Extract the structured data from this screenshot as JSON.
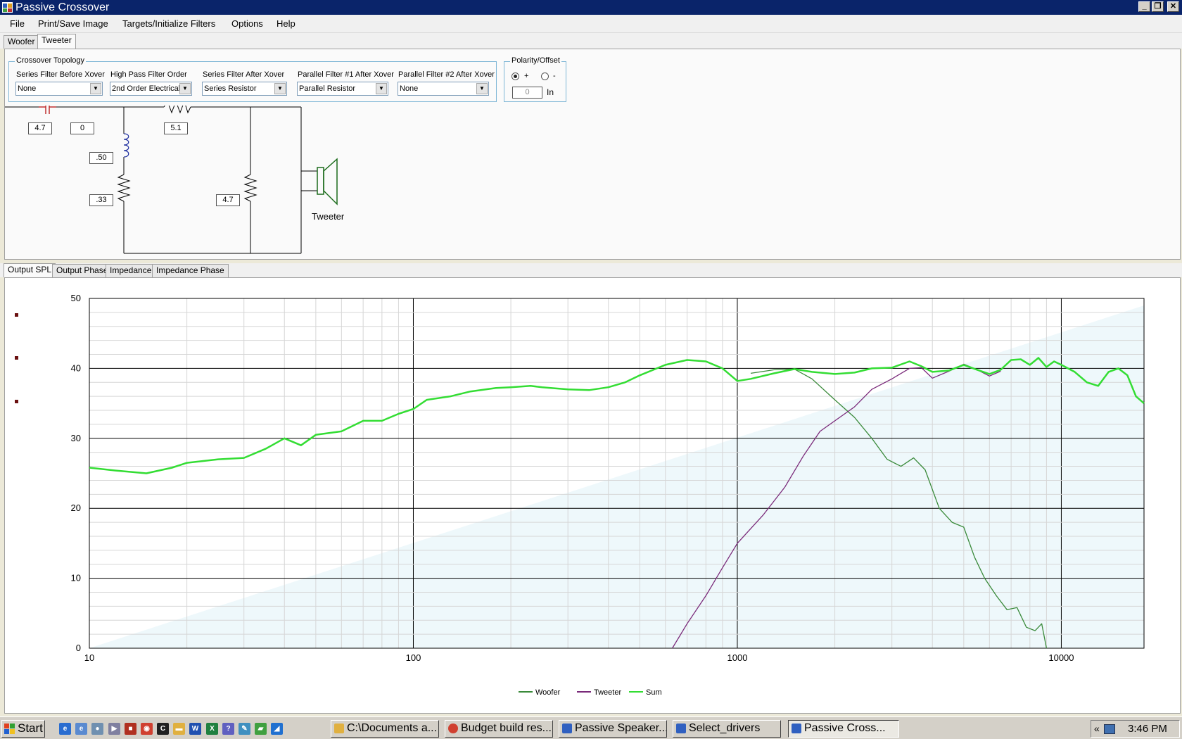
{
  "window": {
    "title": "Passive Crossover"
  },
  "menu": [
    "File",
    "Print/Save Image",
    "Targets/Initialize Filters",
    "Options",
    "Help"
  ],
  "driver_tabs": [
    {
      "label": "Woofer",
      "active": false
    },
    {
      "label": "Tweeter",
      "active": true
    }
  ],
  "topology": {
    "title": "Crossover Topology",
    "filters": [
      {
        "label": "Series Filter Before Xover",
        "value": "None"
      },
      {
        "label": "High Pass Filter Order",
        "value": "2nd Order Electrical"
      },
      {
        "label": "Series Filter After Xover",
        "value": "Series Resistor"
      },
      {
        "label": "Parallel Filter #1 After Xover",
        "value": "Parallel Resistor"
      },
      {
        "label": "Parallel Filter #2 After Xover",
        "value": "None"
      }
    ]
  },
  "polarity": {
    "title": "Polarity/Offset",
    "plus_label": "+",
    "minus_label": "-",
    "selected": "+",
    "offset_value": "0",
    "offset_unit": "In"
  },
  "circuit": {
    "series_cap": "4.7",
    "series_cap_aux": "0",
    "series_res": "5.1",
    "shunt_ind": ".50",
    "shunt_ind_res": ".33",
    "parallel_res": "4.7",
    "driver_label": "Tweeter"
  },
  "graph_tabs": [
    {
      "label": "Output SPL",
      "active": true
    },
    {
      "label": "Output Phase",
      "active": false
    },
    {
      "label": "Impedance",
      "active": false
    },
    {
      "label": "Impedance Phase",
      "active": false
    }
  ],
  "chart_data": {
    "type": "line",
    "x_scale": "log",
    "xlim": [
      10,
      18000
    ],
    "ylim": [
      0,
      50
    ],
    "x_ticks": [
      "10",
      "100",
      "1000",
      "10000"
    ],
    "y_ticks": [
      "0",
      "10",
      "20",
      "30",
      "40",
      "50"
    ],
    "grid": true,
    "legend_position": "bottom-center",
    "series": [
      {
        "name": "Woofer",
        "color": "#3a8a3a",
        "x": [
          1100,
          1300,
          1500,
          1700,
          2000,
          2300,
          2600,
          2900,
          3200,
          3500,
          3800,
          4200,
          4600,
          5000,
          5400,
          5800,
          6300,
          6800,
          7300,
          7800,
          8300,
          8700,
          9000
        ],
        "y": [
          39.3,
          39.8,
          39.9,
          38.5,
          35.5,
          33.0,
          30.0,
          27.0,
          26.0,
          27.2,
          25.5,
          20.0,
          18.0,
          17.3,
          13.0,
          10.0,
          7.5,
          5.5,
          5.8,
          3.0,
          2.5,
          3.5,
          0.0
        ]
      },
      {
        "name": "Tweeter",
        "color": "#7a2a7a",
        "x": [
          630,
          700,
          800,
          900,
          1000,
          1200,
          1400,
          1600,
          1800,
          2000,
          2300,
          2600,
          3000,
          3400,
          3700,
          4000,
          4500,
          5000,
          5500,
          6000,
          6500
        ],
        "y": [
          0.0,
          3.5,
          7.5,
          11.5,
          15.0,
          19.0,
          23.0,
          27.5,
          31.0,
          32.5,
          34.5,
          37.0,
          38.5,
          40.0,
          40.1,
          38.6,
          39.6,
          40.6,
          39.8,
          38.9,
          39.6
        ]
      },
      {
        "name": "Sum",
        "color": "#33dd33",
        "x": [
          10,
          12,
          15,
          18,
          20,
          25,
          30,
          35,
          40,
          45,
          50,
          60,
          70,
          80,
          90,
          100,
          110,
          130,
          150,
          180,
          200,
          230,
          250,
          300,
          350,
          400,
          450,
          500,
          600,
          700,
          800,
          900,
          1000,
          1100,
          1300,
          1500,
          1700,
          2000,
          2300,
          2600,
          3000,
          3400,
          3700,
          4000,
          4500,
          5000,
          5500,
          6000,
          6500,
          7000,
          7500,
          8000,
          8500,
          9000,
          9500,
          10000,
          11000,
          12000,
          13000,
          14000,
          15000,
          16000,
          17000,
          18000
        ],
        "y": [
          25.8,
          25.4,
          25.0,
          25.8,
          26.5,
          27.0,
          27.2,
          28.5,
          30.0,
          29.0,
          30.5,
          31.0,
          32.5,
          32.5,
          33.5,
          34.2,
          35.5,
          36.0,
          36.7,
          37.2,
          37.3,
          37.5,
          37.3,
          37.0,
          36.9,
          37.3,
          38.0,
          39.0,
          40.5,
          41.2,
          41.0,
          40.0,
          38.2,
          38.5,
          39.3,
          39.9,
          39.5,
          39.2,
          39.4,
          40.0,
          40.1,
          41.0,
          40.3,
          39.5,
          39.7,
          40.5,
          39.8,
          39.2,
          39.8,
          41.2,
          41.3,
          40.5,
          41.5,
          40.2,
          41.0,
          40.5,
          39.5,
          38.0,
          37.5,
          39.5,
          40.0,
          39.0,
          36.0,
          35.0
        ]
      }
    ]
  },
  "taskbar": {
    "start": "Start",
    "items": [
      {
        "label": "C:\\Documents a...",
        "active": false
      },
      {
        "label": "Budget build res...",
        "active": false
      },
      {
        "label": "Passive Speaker...",
        "active": false
      },
      {
        "label": "Select_drivers",
        "active": false
      },
      {
        "label": "Passive Cross...",
        "active": true
      }
    ],
    "tray_arrow": "«",
    "clock": "3:46 PM"
  },
  "icons": {
    "app": "crossover-app-icon",
    "minimize": "minimize-icon",
    "maximize": "restore-icon",
    "close": "close-icon",
    "radio": "radio-icon",
    "combo_arrow": "chevron-down-icon",
    "speaker": "speaker-icon",
    "start": "windows-logo-icon",
    "folder": "folder-icon",
    "chrome": "chrome-icon",
    "tray": "network-icon"
  }
}
